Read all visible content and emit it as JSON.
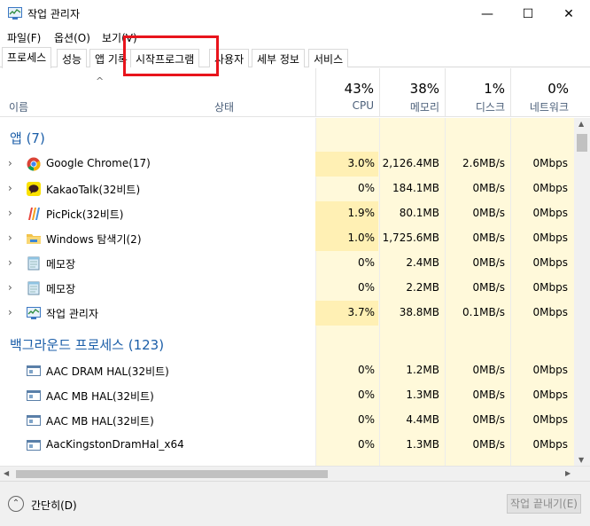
{
  "window": {
    "title": "작업 관리자",
    "minimize": "—",
    "maximize": "☐",
    "close": "✕"
  },
  "menu": [
    "파일(F)",
    "옵션(O)",
    "보기(V)"
  ],
  "tabs": [
    "프로세스",
    "성능",
    "앱 기록",
    "시작프로그램",
    "사용자",
    "세부 정보",
    "서비스"
  ],
  "header": {
    "sort_arrow": "^",
    "name": "이름",
    "status": "상태",
    "cpu": {
      "pct": "43%",
      "label": "CPU"
    },
    "memory": {
      "pct": "38%",
      "label": "메모리"
    },
    "disk": {
      "pct": "1%",
      "label": "디스크"
    },
    "network": {
      "pct": "0%",
      "label": "네트워크"
    }
  },
  "groups": {
    "apps": "앱 (7)",
    "background": "백그라운드 프로세스 (123)"
  },
  "apps": [
    {
      "name": "Google Chrome(17)",
      "cpu": "3.0%",
      "mem": "2,126.4MB",
      "disk": "2.6MB/s",
      "net": "0Mbps",
      "icon": "chrome-icon"
    },
    {
      "name": "KakaoTalk(32비트)",
      "cpu": "0%",
      "mem": "184.1MB",
      "disk": "0MB/s",
      "net": "0Mbps",
      "icon": "kakaotalk-icon"
    },
    {
      "name": "PicPick(32비트)",
      "cpu": "1.9%",
      "mem": "80.1MB",
      "disk": "0MB/s",
      "net": "0Mbps",
      "icon": "picpick-icon"
    },
    {
      "name": "Windows 탐색기(2)",
      "cpu": "1.0%",
      "mem": "1,725.6MB",
      "disk": "0MB/s",
      "net": "0Mbps",
      "icon": "explorer-icon"
    },
    {
      "name": "메모장",
      "cpu": "0%",
      "mem": "2.4MB",
      "disk": "0MB/s",
      "net": "0Mbps",
      "icon": "notepad-icon"
    },
    {
      "name": "메모장",
      "cpu": "0%",
      "mem": "2.2MB",
      "disk": "0MB/s",
      "net": "0Mbps",
      "icon": "notepad-icon"
    },
    {
      "name": "작업 관리자",
      "cpu": "3.7%",
      "mem": "38.8MB",
      "disk": "0.1MB/s",
      "net": "0Mbps",
      "icon": "taskmgr-icon"
    }
  ],
  "background": [
    {
      "name": "AAC DRAM HAL(32비트)",
      "cpu": "0%",
      "mem": "1.2MB",
      "disk": "0MB/s",
      "net": "0Mbps",
      "icon": "service-icon"
    },
    {
      "name": "AAC MB HAL(32비트)",
      "cpu": "0%",
      "mem": "1.3MB",
      "disk": "0MB/s",
      "net": "0Mbps",
      "icon": "service-icon"
    },
    {
      "name": "AAC MB HAL(32비트)",
      "cpu": "0%",
      "mem": "4.4MB",
      "disk": "0MB/s",
      "net": "0Mbps",
      "icon": "service-icon"
    },
    {
      "name": "AacKingstonDramHal_x64",
      "cpu": "0%",
      "mem": "1.3MB",
      "disk": "0MB/s",
      "net": "0Mbps",
      "icon": "service-icon"
    }
  ],
  "footer": {
    "collapse_label": "간단히(D)",
    "end_task": "작업 끝내기(E)"
  },
  "colors": {
    "highlight": "#e8141c",
    "cell_bg": "#fff9da",
    "cpu_bg": "#fff0b4",
    "group_text": "#1b5ea8"
  }
}
